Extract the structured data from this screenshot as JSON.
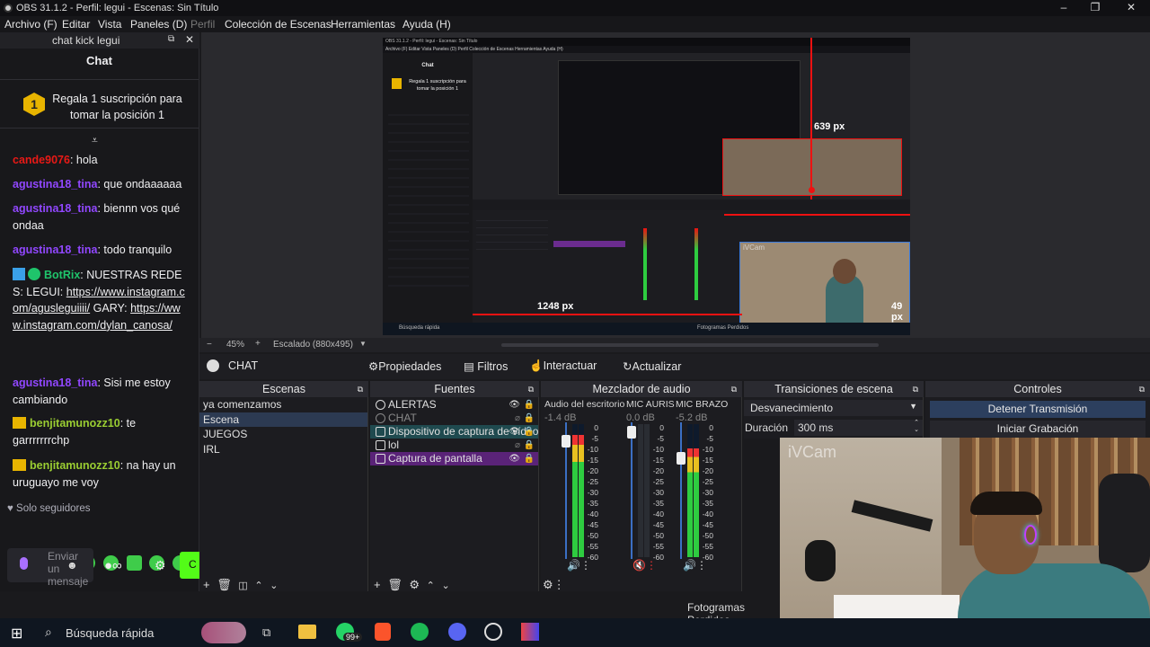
{
  "window": {
    "title": "OBS 31.1.2 - Perfil: legui - Escenas: Sin Título",
    "minimize": "–",
    "maximize": "❐",
    "close": "✕"
  },
  "menu": {
    "items": [
      "Archivo (F)",
      "Editar",
      "Vista",
      "Paneles (D)",
      "Perfil",
      "Colección de Escenas",
      "Herramientas",
      "Ayuda (H)"
    ]
  },
  "chat": {
    "dock_title": "chat kick legui",
    "header": "Chat",
    "pinned": "Regala 1 suscripción para tomar la posición 1",
    "pinned_icon": "1",
    "messages": [
      {
        "user": "cande9076",
        "text": ": hola"
      },
      {
        "user": "agustina18_tina",
        "text": ": que ondaaaaaa"
      },
      {
        "user": "agustina18_tina",
        "text": ": biennn vos qué ondaa"
      },
      {
        "user": "agustina18_tina",
        "text": ": todo tranquilo"
      },
      {
        "user": "BotRix",
        "text": ": NUESTRAS REDES: LEGUI: ",
        "link1": "https://www.instagram.com/agusleguiiii/",
        "mid": " GARY: ",
        "link2": "https://www.instagram.com/dylan_canosa/"
      },
      {
        "user": "agustina18_tina",
        "text": ": Sisi me estoy cambiando"
      },
      {
        "user": "benjitamunozz10",
        "text": ": te garrrrrrrchp"
      },
      {
        "user": "benjitamunozz10",
        "text": ": na hay un uruguayo me voy"
      }
    ],
    "followers_only": "Solo seguidores",
    "send_placeholder": "Enviar un mensaje",
    "send_short": "C"
  },
  "preview": {
    "label_639": "639 px",
    "label_1248": "1248 px",
    "label_49": "49 px",
    "inner_chat_header": "Chat",
    "inner_pinned": "Regala 1 suscripción para tomar la posición 1",
    "inner_status": "Fotogramas Perdidos",
    "inner_menu": "Archivo (F)  Editar  Vista  Paneles (D)  Perfil  Colección de Escenas  Herramientas  Ayuda (H)",
    "inner_search": "Búsqueda rápida",
    "webcam_label": "iVCam"
  },
  "scene_bar": {
    "zoom": "45%",
    "scaling": "Escalado (880x495)"
  },
  "context_bar": {
    "scene_name": "CHAT",
    "properties": "Propiedades",
    "filters": "Filtros",
    "interact": "Interactuar",
    "refresh": "Actualizar"
  },
  "panels": {
    "scenes": {
      "title": "Escenas",
      "items": [
        "ya comenzamos",
        "Escena",
        "JUEGOS",
        "IRL"
      ],
      "selected": 1
    },
    "sources": {
      "title": "Fuentes",
      "items": [
        "ALERTAS",
        "CHAT",
        "Dispositivo de captura de vídeo",
        "lol",
        "Captura de pantalla"
      ]
    },
    "mixer": {
      "title": "Mezclador de audio",
      "channels": [
        {
          "name": "Audio del escritorio",
          "db": "-1.4 dB",
          "level": 0.92
        },
        {
          "name": "MIC AURIS",
          "db": "0.0 dB",
          "level": 0.0
        },
        {
          "name": "MIC BRAZO",
          "db": "-5.2 dB",
          "level": 0.82
        }
      ],
      "scale": [
        "0",
        "-5",
        "-10",
        "-15",
        "-20",
        "-25",
        "-30",
        "-35",
        "-40",
        "-45",
        "-50",
        "-55",
        "-60"
      ]
    },
    "transitions": {
      "title": "Transiciones de escena",
      "selected": "Desvanecimiento",
      "duration_label": "Duración",
      "duration_value": "300 ms"
    },
    "controls": {
      "title": "Controles",
      "stop_stream": "Detener Transmisión",
      "start_record": "Iniciar Grabación"
    }
  },
  "status": {
    "dropped_frames": "Fotogramas Perdidos"
  },
  "webcam": {
    "label": "iVCam"
  },
  "taskbar": {
    "search": "Búsqueda rápida",
    "badge": "99+"
  },
  "colors": {
    "accent": "#1fc46b",
    "kick_green": "#53fc18",
    "selection": "#2c3a52",
    "meter_green": "#2ecc40"
  }
}
